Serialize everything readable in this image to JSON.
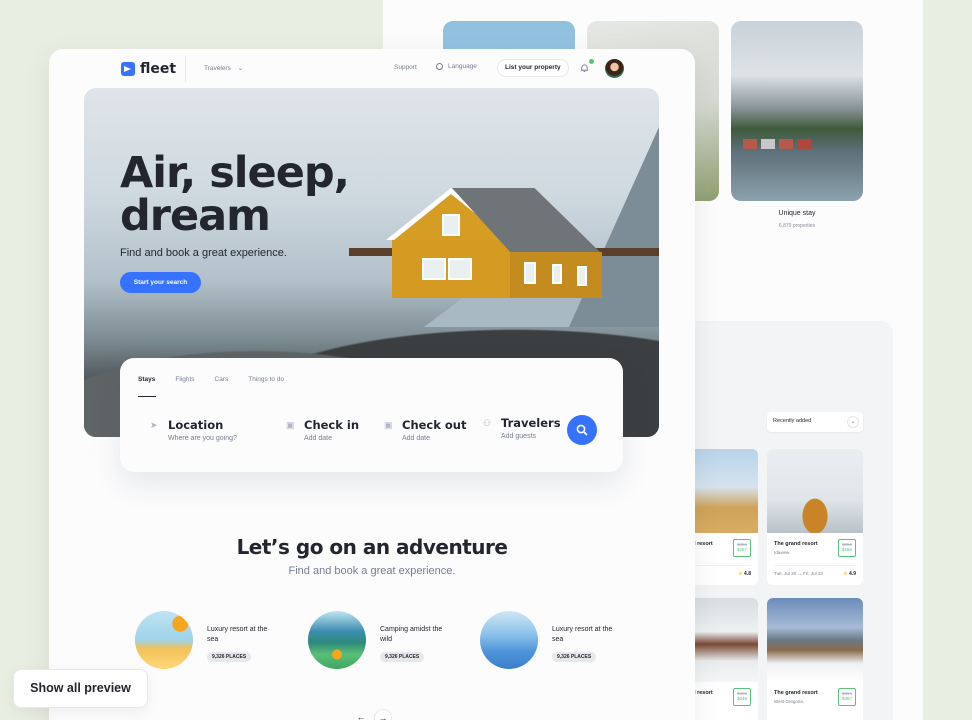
{
  "back": {
    "unique_stay": {
      "title": "Unique stay",
      "count": "6,879 properties"
    },
    "sort_select": "Recently added",
    "properties": [
      {
        "name": "The grand resort",
        "location": "",
        "old_price": "$356",
        "price": "$267",
        "dates": "Fri, Jul 23",
        "rating": "4.8"
      },
      {
        "name": "The grand resort",
        "location": "Idaview",
        "old_price": "$356",
        "price": "$256",
        "dates": "Tue, Jul 20  →  Fri, Jul 23",
        "rating": "4.9"
      },
      {
        "name": "The grand resort",
        "location": "",
        "old_price": "$356",
        "price": "$548",
        "dates": "",
        "rating": ""
      },
      {
        "name": "The grand resort",
        "location": "West Gregoria",
        "old_price": "$356",
        "price": "$367",
        "dates": "",
        "rating": ""
      }
    ]
  },
  "nav": {
    "brand": "fleet",
    "travelers": "Travelers",
    "support": "Support",
    "language": "Language",
    "list_property": "List your property"
  },
  "hero": {
    "title_line1": "Air, sleep,",
    "title_line2": "dream",
    "subtitle": "Find and book a great experience.",
    "cta": "Start your search"
  },
  "search": {
    "tabs": [
      "Stays",
      "Flights",
      "Cars",
      "Things to do"
    ],
    "fields": [
      {
        "label": "Location",
        "hint": "Where are you going?"
      },
      {
        "label": "Check in",
        "hint": "Add date"
      },
      {
        "label": "Check out",
        "hint": "Add date"
      },
      {
        "label": "Travelers",
        "hint": "Add guests"
      }
    ]
  },
  "adventure": {
    "title": "Let’s go on an adventure",
    "subtitle": "Find and book a great experience.",
    "categories": [
      {
        "name": "Luxury resort at the sea",
        "badge": "9,326 PLACES"
      },
      {
        "name": "Camping amidst the wild",
        "badge": "9,326 PLACES"
      },
      {
        "name": "Luxury resort at the sea",
        "badge": "9,326 PLACES"
      }
    ]
  },
  "pager": {
    "prev": "←",
    "next": "→"
  },
  "show_all": "Show all preview",
  "colors": {
    "accent": "#3772ff",
    "success": "#58c27d",
    "text": "#23262f",
    "muted": "#777e90"
  }
}
